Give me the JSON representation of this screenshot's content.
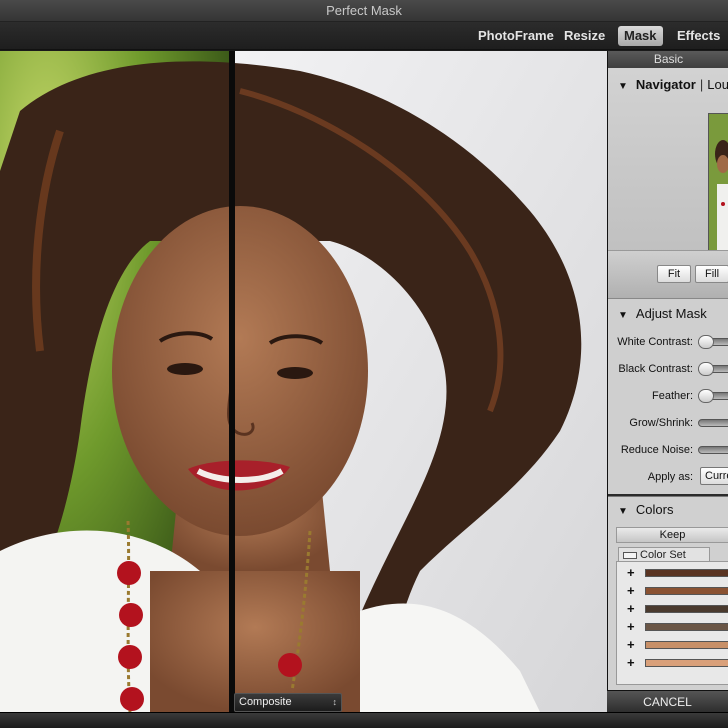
{
  "window": {
    "title": "Perfect Mask"
  },
  "modules": [
    {
      "label": "PhotoFrame"
    },
    {
      "label": "Resize"
    },
    {
      "label": "Mask"
    },
    {
      "label": "Effects"
    }
  ],
  "canvas": {
    "view_mode": "Composite"
  },
  "panel": {
    "tab": "Basic",
    "navigator": {
      "title": "Navigator",
      "separator": "|",
      "loupe": "Lou"
    },
    "zoom_buttons": {
      "fit": "Fit",
      "fill": "Fill"
    },
    "adjust_mask": {
      "title": "Adjust Mask",
      "white_contrast": "White Contrast:",
      "black_contrast": "Black Contrast:",
      "feather": "Feather:",
      "grow_shrink": "Grow/Shrink:",
      "reduce_noise": "Reduce Noise:",
      "apply_as": "Apply as:",
      "apply_as_value": "Curre"
    },
    "colors": {
      "title": "Colors",
      "keep": "Keep",
      "color_set": "Color Set",
      "swatches": [
        "#5a3422",
        "#8a5232",
        "#4a3a2e",
        "#6a5646",
        "#c89068",
        "#d9a07a"
      ]
    },
    "cancel": "CANCEL"
  }
}
